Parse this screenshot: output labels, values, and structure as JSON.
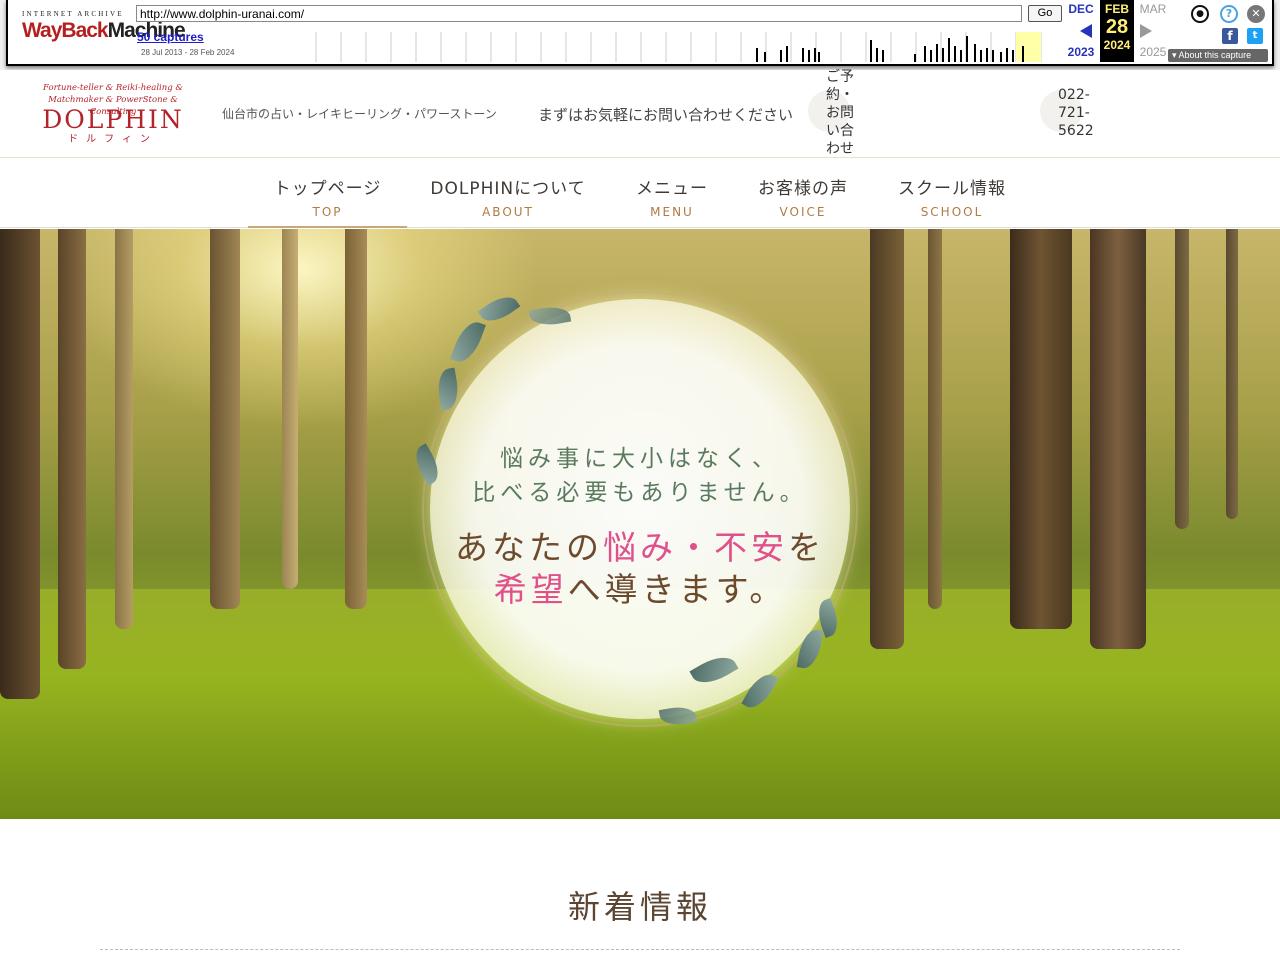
{
  "wayback": {
    "logo_top": "INTERNET ARCHIVE",
    "logo_way": "WayBack",
    "logo_machine": "Machine",
    "url": "http://www.dolphin-uranai.com/",
    "go_label": "Go",
    "captures": "50 captures",
    "range": "28 Jul 2013 - 28 Feb 2024",
    "prev_month": "DEC",
    "prev_year": "2023",
    "cur_month": "FEB",
    "cur_day": "28",
    "cur_year": "2024",
    "next_month": "MAR",
    "next_year": "2025",
    "about_label": "About this capture",
    "colors": {
      "accent": "#2933b8",
      "current_bg": "#000000",
      "current_text": "#ffef7a"
    }
  },
  "header": {
    "logo_sub": "Fortune-teller & Reiki-healing & Matchmaker & PowerStone & Consulting",
    "logo_main": "DOLPHIN",
    "logo_kana": "ドルフィン",
    "tagline": "仙台市の占い・レイキヒーリング・パワーストーン",
    "contact_message": "まずはお気軽にお問い合わせください",
    "contact_button": "ご予約・お問い合わせ",
    "tel": "022-721-5622",
    "brand_color": "#b3232b"
  },
  "nav": [
    {
      "jp": "トップページ",
      "en": "TOP",
      "active": true
    },
    {
      "jp": "DOLPHINについて",
      "en": "ABOUT",
      "active": false
    },
    {
      "jp": "メニュー",
      "en": "MENU",
      "active": false
    },
    {
      "jp": "お客様の声",
      "en": "VOICE",
      "active": false
    },
    {
      "jp": "スクール情報",
      "en": "SCHOOL",
      "active": false
    }
  ],
  "hero": {
    "line1": "悩み事に大小はなく、",
    "line2": "比べる必要もありません。",
    "line3_a": "あなたの",
    "line3_b": "悩み・不安",
    "line3_c": "を",
    "line4_a": "希望",
    "line4_b": "へ導きます。",
    "highlight_color": "#e0508a"
  },
  "news": {
    "title": "新着情報"
  }
}
